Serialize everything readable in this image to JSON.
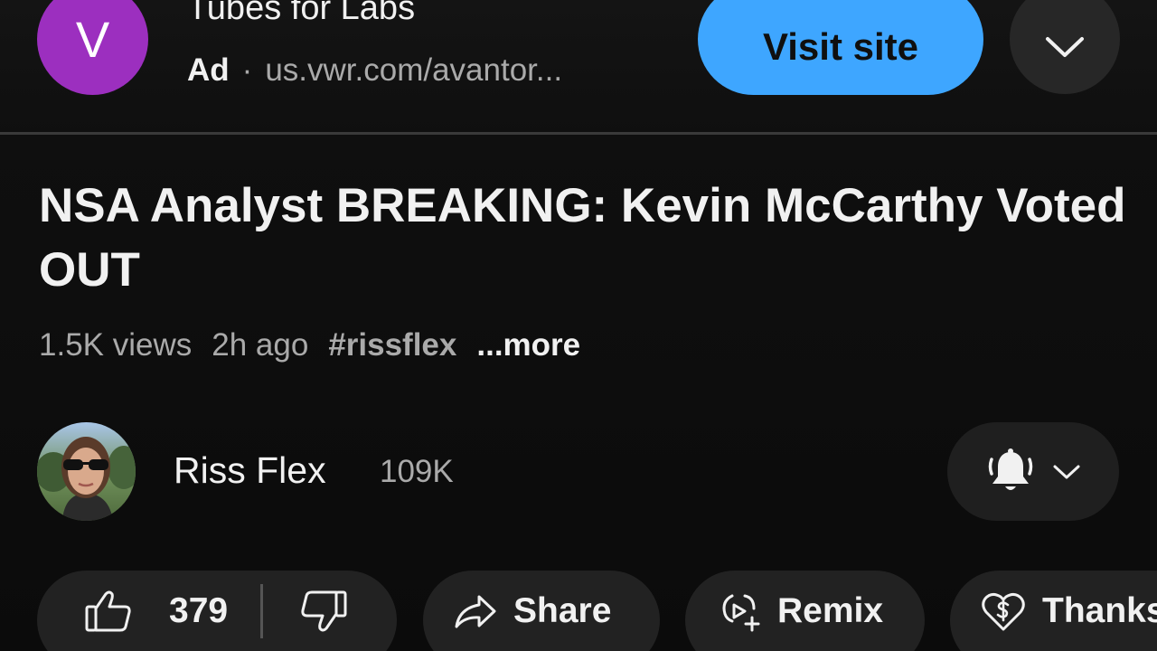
{
  "ad": {
    "avatar_letter": "V",
    "avatar_color": "#9c2fbf",
    "title": "Tubes for Labs",
    "badge": "Ad",
    "separator": "·",
    "url": "us.vwr.com/avantor...",
    "cta_label": "Visit site",
    "cta_color": "#3ea6ff",
    "expand_icon": "chevron-down-icon"
  },
  "video": {
    "title": "NSA Analyst BREAKING: Kevin McCarthy Voted OUT",
    "views": "1.5K views",
    "age": "2h ago",
    "hashtag": "#rissflex",
    "more_label": "...more"
  },
  "channel": {
    "name": "Riss Flex",
    "subscribers": "109K",
    "notification_icon": "bell-icon"
  },
  "actions": {
    "like_count": "379",
    "share_label": "Share",
    "remix_label": "Remix",
    "thanks_label": "Thanks"
  },
  "colors": {
    "background": "#0f0f0f",
    "pill": "#222222",
    "secondary_text": "#aaaaaa"
  }
}
